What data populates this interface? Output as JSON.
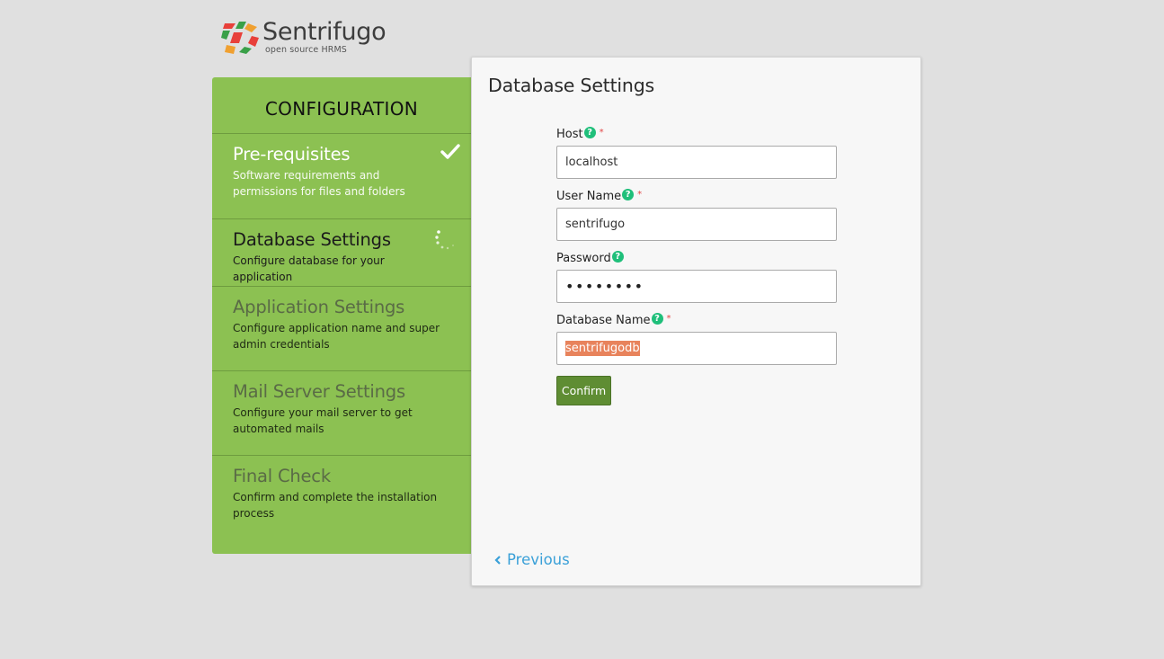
{
  "brand": {
    "name": "Sentrifugo",
    "tagline": "open source HRMS"
  },
  "sidebar": {
    "title": "CONFIGURATION",
    "steps": [
      {
        "title": "Pre-requisites",
        "desc": "Software requirements and permissions for files and folders",
        "state": "done"
      },
      {
        "title": "Database Settings",
        "desc": "Configure database for your application",
        "state": "active"
      },
      {
        "title": "Application Settings",
        "desc": "Configure application name and super admin credentials",
        "state": "pending"
      },
      {
        "title": "Mail Server Settings",
        "desc": "Configure your mail server to get automated mails",
        "state": "pending"
      },
      {
        "title": "Final Check",
        "desc": "Confirm and complete the installation process",
        "state": "pending"
      }
    ]
  },
  "main": {
    "title": "Database Settings",
    "fields": {
      "host": {
        "label": "Host",
        "value": "localhost",
        "required": "*"
      },
      "username": {
        "label": "User Name",
        "value": "sentrifugo",
        "required": "*"
      },
      "password": {
        "label": "Password",
        "value": "••••••••"
      },
      "dbname": {
        "label": "Database Name",
        "value": "sentrifugodb",
        "required": "*"
      }
    },
    "confirm_label": "Confirm",
    "previous_label": "Previous"
  },
  "colors": {
    "sidebar_bg": "#8cc152",
    "button_bg": "#5f8d33",
    "link": "#3aa0d8",
    "help": "#1fbf7a",
    "required": "#e34848"
  }
}
